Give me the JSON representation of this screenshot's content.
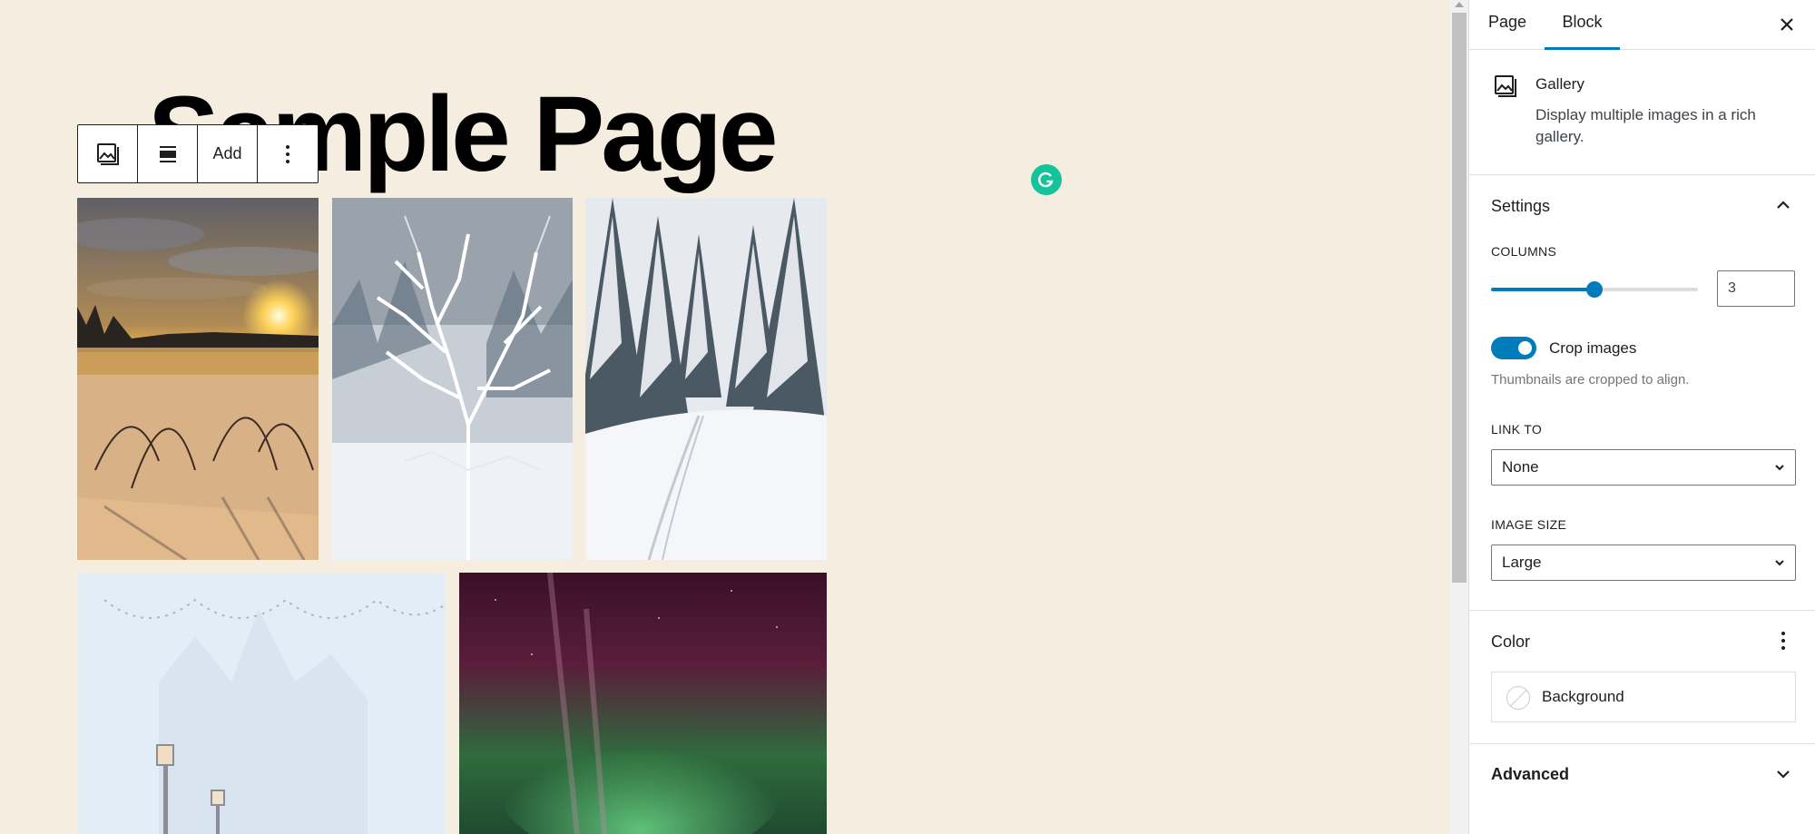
{
  "editor": {
    "page_title": "Sample Page",
    "toolbar": {
      "block_type_icon": "gallery-icon",
      "align_icon": "align-icon",
      "add_label": "Add",
      "more_icon": "more-vertical-icon"
    },
    "gallery_images": [
      {
        "alt": "winter-sunset-icon"
      },
      {
        "alt": "frosted-tree-icon"
      },
      {
        "alt": "snowy-forest-path-icon"
      },
      {
        "alt": "frosted-castle-icon"
      },
      {
        "alt": "aurora-icon"
      }
    ],
    "grammarly_icon": "grammarly-icon"
  },
  "sidebar": {
    "tabs": [
      {
        "label": "Page"
      },
      {
        "label": "Block",
        "active": true
      }
    ],
    "close_icon": "close-icon",
    "block": {
      "name": "Gallery",
      "description": "Display multiple images in a rich gallery."
    },
    "settings": {
      "title": "Settings",
      "columns_label": "COLUMNS",
      "columns_value": "3",
      "columns_slider_fraction": 0.5,
      "crop_label": "Crop images",
      "crop_enabled": true,
      "crop_help": "Thumbnails are cropped to align.",
      "link_to_label": "LINK TO",
      "link_to_value": "None",
      "image_size_label": "IMAGE SIZE",
      "image_size_value": "Large"
    },
    "color": {
      "title": "Color",
      "background_label": "Background"
    },
    "advanced": {
      "title": "Advanced"
    }
  },
  "colors": {
    "accent": "#007cba",
    "canvas_bg": "#f5eee0",
    "grammarly": "#15c39a"
  }
}
